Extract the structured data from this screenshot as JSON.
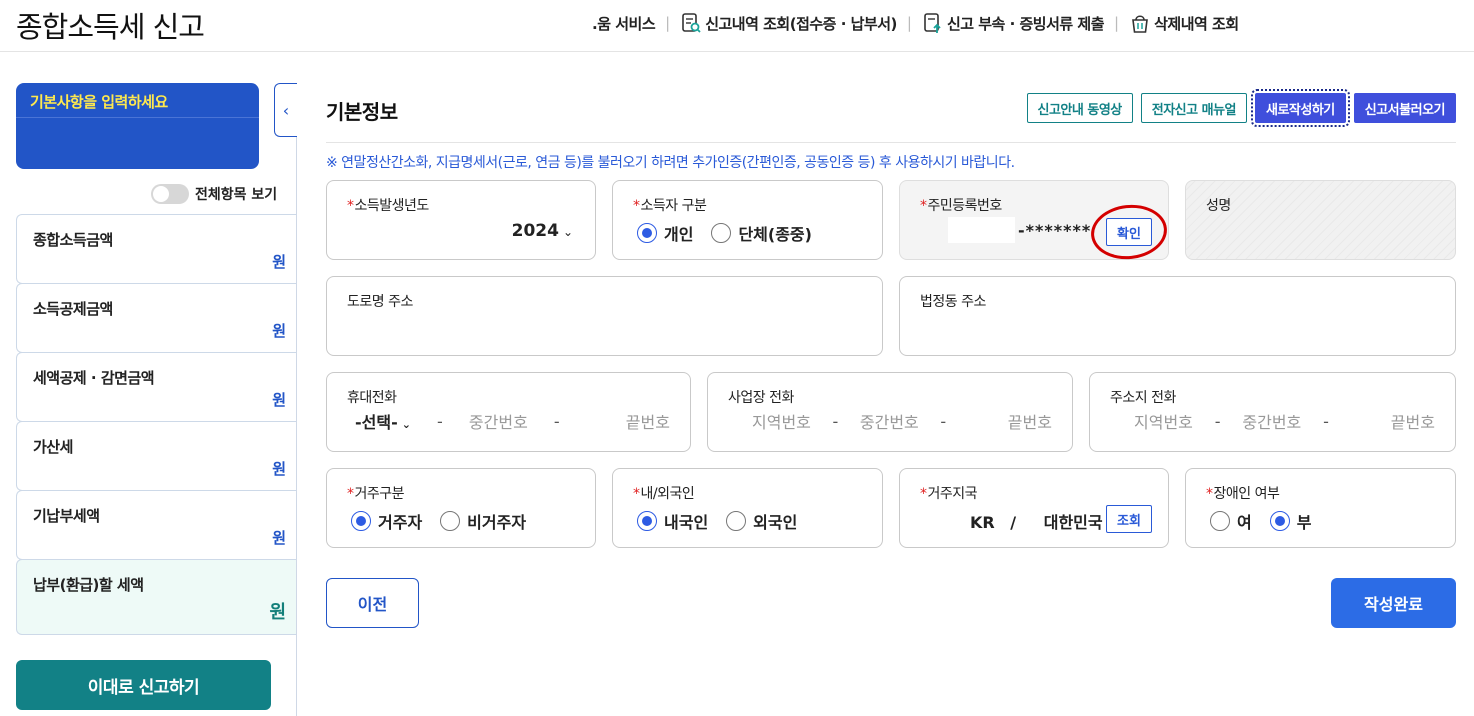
{
  "header": {
    "title": "종합소득세 신고",
    "nav": [
      {
        "label": ".움 서비스"
      },
      {
        "label": "신고내역 조회(접수증 · 납부서)",
        "icon": "document-search-icon"
      },
      {
        "label": "신고 부속 · 증빙서류 제출",
        "icon": "document-upload-icon"
      },
      {
        "label": "삭제내역 조회",
        "icon": "trash-basket-icon"
      }
    ]
  },
  "sidebar": {
    "guide_title": "기본사항을 입력하세요",
    "toggle_label": "전체항목 보기",
    "items": [
      {
        "label": "종합소득금액",
        "unit": "원"
      },
      {
        "label": "소득공제금액",
        "unit": "원"
      },
      {
        "label": "세액공제 · 감면금액",
        "unit": "원"
      },
      {
        "label": "가산세",
        "unit": "원"
      },
      {
        "label": "기납부세액",
        "unit": "원"
      },
      {
        "label": "납부(환급)할 세액",
        "unit": "원"
      }
    ],
    "report_button": "이대로 신고하기"
  },
  "main": {
    "title": "기본정보",
    "buttons": {
      "guide_video": "신고안내 동영상",
      "manual": "전자신고 매뉴얼",
      "new": "새로작성하기",
      "load": "신고서불러오기"
    },
    "notice": "※ 연말정산간소화, 지급명세서(근로, 연금 등)를 불러오기 하려면 추가인증(간편인증, 공동인증 등) 후 사용하시기 바랍니다.",
    "income_year": {
      "label": "소득발생년도",
      "value": "2024"
    },
    "earner_type": {
      "label": "소득자 구분",
      "options": [
        "개인",
        "단체(종중)"
      ],
      "selected": "개인"
    },
    "rrn": {
      "label": "주민등록번호",
      "masked_tail": "-*******",
      "confirm": "확인"
    },
    "name": {
      "label": "성명"
    },
    "road_address": {
      "label": "도로명 주소"
    },
    "legal_address": {
      "label": "법정동 주소"
    },
    "mobile": {
      "label": "휴대전화",
      "select": "-선택-",
      "middle_ph": "중간번호",
      "last_ph": "끝번호"
    },
    "work_phone": {
      "label": "사업장 전화",
      "area_ph": "지역번호",
      "middle_ph": "중간번호",
      "last_ph": "끝번호"
    },
    "home_phone": {
      "label": "주소지 전화",
      "area_ph": "지역번호",
      "middle_ph": "중간번호",
      "last_ph": "끝번호"
    },
    "residency": {
      "label": "거주구분",
      "options": [
        "거주자",
        "비거주자"
      ],
      "selected": "거주자"
    },
    "nationality": {
      "label": "내/외국인",
      "options": [
        "내국인",
        "외국인"
      ],
      "selected": "내국인"
    },
    "res_country": {
      "label": "거주지국",
      "code": "KR",
      "slash": "/",
      "name": "대한민국",
      "lookup": "조회"
    },
    "disabled": {
      "label": "장애인 여부",
      "options": [
        "여",
        "부"
      ],
      "selected": "부"
    },
    "prev_button": "이전",
    "done_button": "작성완료"
  }
}
